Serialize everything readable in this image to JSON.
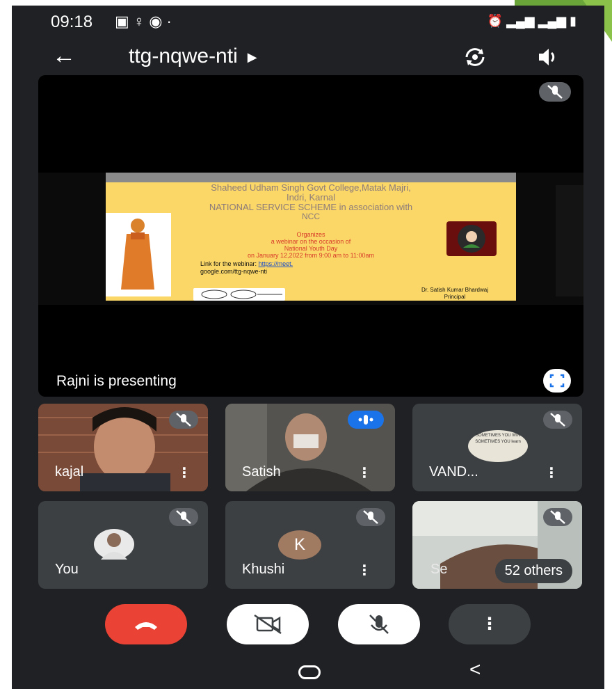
{
  "status_bar": {
    "time": "09:18",
    "icons": [
      "gallery-icon",
      "person-icon",
      "chrome-icon",
      "dot"
    ],
    "right_icons": [
      "alarm-icon",
      "volte-lte1-icon",
      "signal-icon",
      "volte-lte2-icon",
      "battery-icon"
    ]
  },
  "meeting": {
    "code": "ttg-nqwe-nti"
  },
  "presentation": {
    "presenter_label": "Rajni is presenting",
    "slide": {
      "line1": "Shaheed Udham Singh Govt College,Matak Majri,",
      "line2": "Indri, Karnal",
      "line3": "NATIONAL SERVICE SCHEME in association with",
      "line4": "NCC",
      "organizes": "Organizes",
      "webinar": "a webinar on the occasion of",
      "occasion": "National Youth Day",
      "date": "on January 12,2022 from 9:00 am to 11:00am",
      "link_label": "Link for the webinar:",
      "link_url": "https://meet.",
      "link_url2": "google.com/ttg-nqwe-nti",
      "signatory": "Dr. Satish Kumar Bhardwaj",
      "designation": "Principal"
    }
  },
  "participants": [
    {
      "name": "kajal"
    },
    {
      "name": "Satish"
    },
    {
      "name": "VAND..."
    },
    {
      "name": "You"
    },
    {
      "name": "Khushi",
      "initial": "K"
    },
    {
      "name": "Se"
    }
  ],
  "others_badge": "52 others",
  "avatar_vand_text": "SOMETIMES YOU WIN SOMETIMES YOU learn",
  "colors": {
    "background": "#202124",
    "tile": "#3c4043",
    "end_call": "#ea4335",
    "speaking": "#1a73e8",
    "slide": "#fad767"
  }
}
